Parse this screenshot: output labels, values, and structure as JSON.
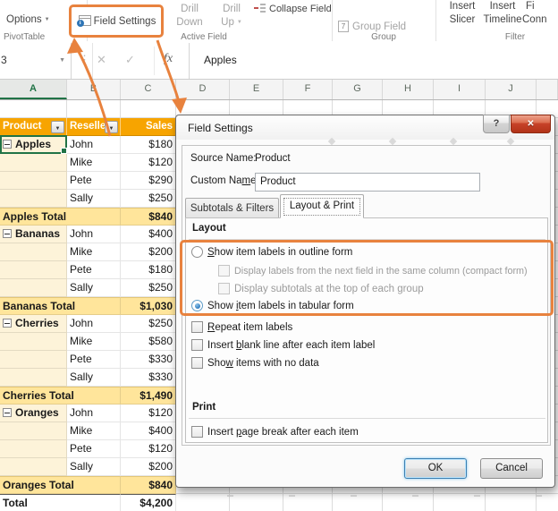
{
  "colors": {
    "accent_orange": "#E8823E",
    "pivot_header_gold": "#F7A400",
    "pivot_subtotal_gold": "#FFE59B",
    "pivot_item_cream": "#FDF3D9",
    "excel_green": "#217346",
    "close_button_red": "#C8432A",
    "default_button_blue": "#3C7FB1"
  },
  "ribbon": {
    "options_label": "Options",
    "pivottable_group_label": "PivotTable",
    "field_settings_label": "Field Settings",
    "drill_down_line1": "Drill",
    "drill_down_line2": "Down",
    "drill_up_line1": "Drill",
    "drill_up_line2": "Up",
    "active_field_group_label": "Active Field",
    "collapse_field_label": "Collapse Field",
    "group_field_label": "Group Field",
    "group_group_label": "Group",
    "insert_slicer_line1": "Insert",
    "insert_slicer_line2": "Slicer",
    "insert_timeline_line1": "Insert",
    "insert_timeline_line2": "Timeline",
    "filter_connections_line1": "Fi",
    "filter_connections_line2": "Conn",
    "filter_group_label": "Filter"
  },
  "formula_bar": {
    "name_box_value": "3",
    "formula_value": "Apples"
  },
  "icons": {
    "dropdown_caret": "▼",
    "cancel_glyph": "✕",
    "enter_glyph": "✓",
    "fx_glyph": "fx",
    "info_glyph": "i",
    "group_field_glyph": "7",
    "more_dots_glyph": "⋮",
    "help_glyph": "?",
    "close_glyph": "✕"
  },
  "sheet": {
    "column_letters": [
      "A",
      "B",
      "C",
      "D",
      "E",
      "F",
      "G",
      "H",
      "I",
      "J",
      ""
    ],
    "pivot": {
      "headers": [
        "Product",
        "Reseller",
        "Sales"
      ],
      "rows": [
        {
          "type": "group",
          "product": "Apples",
          "reseller": "John",
          "sales": "$180",
          "selected": true
        },
        {
          "type": "detail",
          "reseller": "Mike",
          "sales": "$120"
        },
        {
          "type": "detail",
          "reseller": "Pete",
          "sales": "$290"
        },
        {
          "type": "detail",
          "reseller": "Sally",
          "sales": "$250"
        },
        {
          "type": "subtotal",
          "label": "Apples Total",
          "sales": "$840"
        },
        {
          "type": "group",
          "product": "Bananas",
          "reseller": "John",
          "sales": "$400"
        },
        {
          "type": "detail",
          "reseller": "Mike",
          "sales": "$200"
        },
        {
          "type": "detail",
          "reseller": "Pete",
          "sales": "$180"
        },
        {
          "type": "detail",
          "reseller": "Sally",
          "sales": "$250"
        },
        {
          "type": "subtotal",
          "label": "Bananas Total",
          "sales": "$1,030"
        },
        {
          "type": "group",
          "product": "Cherries",
          "reseller": "John",
          "sales": "$250"
        },
        {
          "type": "detail",
          "reseller": "Mike",
          "sales": "$580"
        },
        {
          "type": "detail",
          "reseller": "Pete",
          "sales": "$330"
        },
        {
          "type": "detail",
          "reseller": "Sally",
          "sales": "$330"
        },
        {
          "type": "subtotal",
          "label": "Cherries Total",
          "sales": "$1,490"
        },
        {
          "type": "group",
          "product": "Oranges",
          "reseller": "John",
          "sales": "$120"
        },
        {
          "type": "detail",
          "reseller": "Mike",
          "sales": "$400"
        },
        {
          "type": "detail",
          "reseller": "Pete",
          "sales": "$120"
        },
        {
          "type": "detail",
          "reseller": "Sally",
          "sales": "$200"
        },
        {
          "type": "subtotal",
          "label": "Oranges Total",
          "sales": "$840"
        },
        {
          "type": "grandtotal",
          "label": "Total",
          "sales": "$4,200"
        }
      ]
    }
  },
  "dialog": {
    "title": "Field Settings",
    "source_name_label": "Source Name:",
    "source_name_value": "Product",
    "custom_name": {
      "pre": "Custom Na",
      "u": "m",
      "post": "e:"
    },
    "custom_name_value": "Product",
    "tab_subtotals": "Subtotals & Filters",
    "tab_layout": "Layout & Print",
    "layout_section_label": "Layout",
    "radio_outline": {
      "pre": "",
      "u": "S",
      "post": "how item labels in outline form"
    },
    "check_compact_label": "Display labels from the next field in the same column (compact form)",
    "check_subtotals_top_label": "Display subtotals at the top of each group",
    "radio_tabular": {
      "pre": "Show ",
      "u": "i",
      "post": "tem labels in tabular form"
    },
    "check_repeat": {
      "pre": "",
      "u": "R",
      "post": "epeat item labels"
    },
    "check_blank_line": {
      "pre": "Insert ",
      "u": "b",
      "post": "lank line after each item label"
    },
    "check_no_data": {
      "pre": "Sho",
      "u": "w",
      "post": " items with no data"
    },
    "print_section_label": "Print",
    "check_page_break": {
      "pre": "Insert ",
      "u": "p",
      "post": "age break after each item"
    },
    "ok_label": "OK",
    "cancel_label": "Cancel"
  }
}
